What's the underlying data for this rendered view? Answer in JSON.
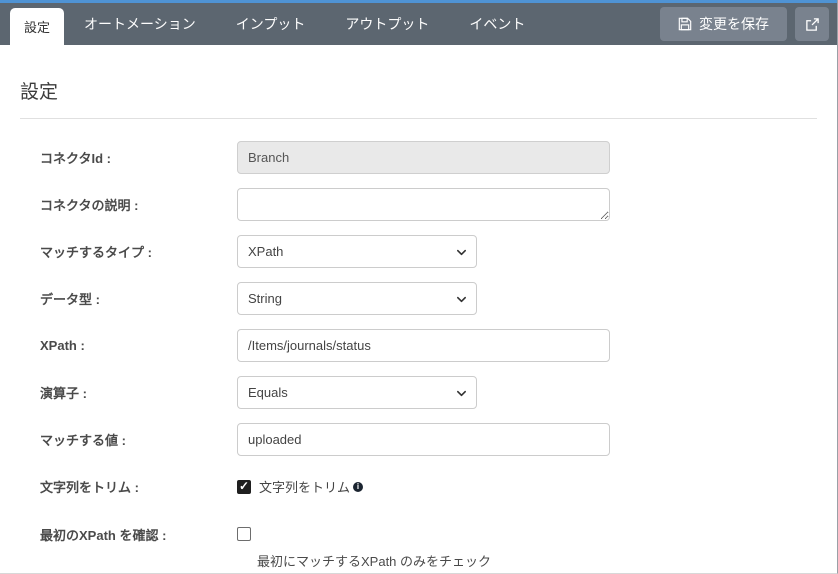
{
  "colors": {
    "accent_line": "#4f93d4",
    "topbar_bg": "#5c6670",
    "button_bg": "#79828e",
    "active_tab_text": "#333333",
    "checkbox_checked": "#1f1f1f"
  },
  "tabs": {
    "items": [
      {
        "label": "設定",
        "active": true
      },
      {
        "label": "オートメーション",
        "active": false
      },
      {
        "label": "インプット",
        "active": false
      },
      {
        "label": "アウトプット",
        "active": false
      },
      {
        "label": "イベント",
        "active": false
      }
    ]
  },
  "toolbar": {
    "save_label": "変更を保存",
    "save_icon": "floppy-disk-icon",
    "external_icon": "external-link-icon"
  },
  "page": {
    "title": "設定"
  },
  "form": {
    "fields": [
      {
        "label": "コネクタId :",
        "type": "text",
        "value": "Branch",
        "disabled": true
      },
      {
        "label": "コネクタの説明 :",
        "type": "textarea",
        "value": ""
      },
      {
        "label": "マッチするタイプ :",
        "type": "select",
        "value": "XPath"
      },
      {
        "label": "データ型 :",
        "type": "select",
        "value": "String"
      },
      {
        "label": "XPath :",
        "type": "text",
        "value": "/Items/journals/status"
      },
      {
        "label": "演算子 :",
        "type": "select",
        "value": "Equals"
      },
      {
        "label": "マッチする値 :",
        "type": "text",
        "value": "uploaded"
      },
      {
        "label": "文字列をトリム :",
        "type": "checkbox",
        "checked": true,
        "checked_attr": "checked",
        "checkbox_label": "文字列をトリム",
        "has_info_icon": true,
        "info_glyph": "i"
      },
      {
        "label": "最初のXPath を確認 :",
        "type": "checkbox",
        "checked": false,
        "helper": "最初にマッチするXPath のみをチェック"
      }
    ]
  }
}
